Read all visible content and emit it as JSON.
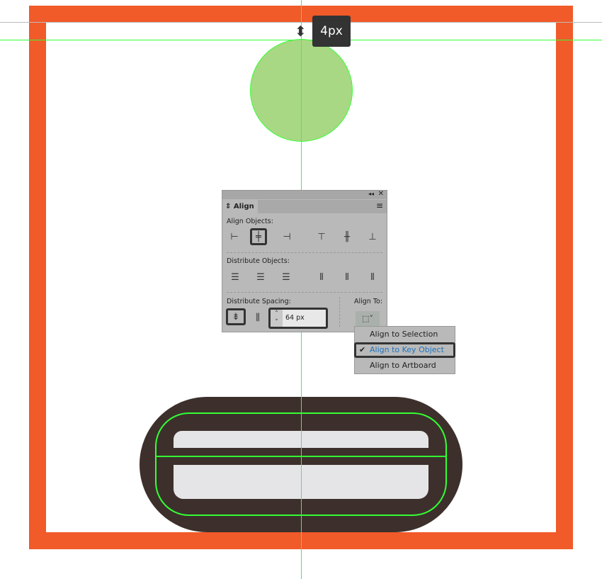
{
  "canvas": {
    "frame_color": "#f15a29",
    "guide_color": "#33ff33",
    "circle_color": "#a8d883",
    "pill_color": "#3d302c",
    "bar_color": "#e5e5e7"
  },
  "tooltip": {
    "text": "4px",
    "icon": "vertical-resize-arrows-icon"
  },
  "panel": {
    "title": "Align",
    "collapse_icon": "double-chevron-left-icon",
    "close_icon": "close-icon",
    "menu_icon": "hamburger-icon",
    "align_objects_label": "Align Objects:",
    "distribute_objects_label": "Distribute Objects:",
    "distribute_spacing_label": "Distribute Spacing:",
    "align_to_label": "Align To:",
    "spacing_value": "64 px"
  },
  "menu": {
    "items": [
      {
        "label": "Align to Selection"
      },
      {
        "label": "Align to Key Object",
        "checked": true
      },
      {
        "label": "Align to Artboard"
      }
    ],
    "checkmark": "✔",
    "active_color": "#1e73be"
  }
}
